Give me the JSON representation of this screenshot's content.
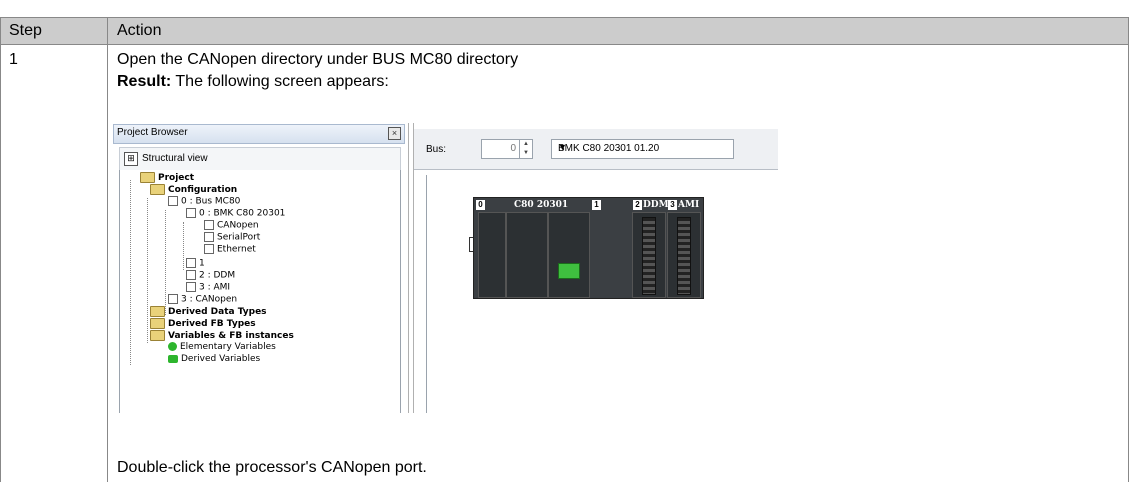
{
  "table": {
    "headers": {
      "step": "Step",
      "action": "Action"
    },
    "row": {
      "step": "1",
      "line1": "Open the CANopen directory under BUS MC80 directory",
      "result_label": "Result:",
      "result_text": " The following screen appears:",
      "line3": "Double-click the processor's CANopen port."
    }
  },
  "screenshot": {
    "project_browser": {
      "title": "Project Browser",
      "view_label": "Structural view",
      "tree": [
        {
          "label": "Project",
          "bold": true
        },
        {
          "label": "Configuration",
          "bold": true
        },
        {
          "label": "0 : Bus MC80",
          "bold": false
        },
        {
          "label": "0 : BMK C80 20301",
          "bold": false
        },
        {
          "label": "CANopen",
          "bold": false
        },
        {
          "label": "SerialPort",
          "bold": false
        },
        {
          "label": "Ethernet",
          "bold": false
        },
        {
          "label": "1",
          "bold": false
        },
        {
          "label": "2 : DDM",
          "bold": false
        },
        {
          "label": "3 : AMI",
          "bold": false
        },
        {
          "label": "3 : CANopen",
          "bold": false
        },
        {
          "label": "Derived Data Types",
          "bold": true
        },
        {
          "label": "Derived FB Types",
          "bold": true
        },
        {
          "label": "Variables & FB instances",
          "bold": true
        },
        {
          "label": "Elementary Variables",
          "bold": false
        },
        {
          "label": "Derived Variables",
          "bold": false
        }
      ]
    },
    "bus_editor": {
      "bus_label": "Bus:",
      "bus_number": "0",
      "bus_select": "BMK C80 20301   01.20",
      "rack": {
        "slot0": "0",
        "cpu_label": "C80 20301",
        "slot1": "1",
        "slot2": "2",
        "ddm": "DDM",
        "slot3": "3",
        "ami": "AMI",
        "rack_number": "0"
      }
    }
  }
}
